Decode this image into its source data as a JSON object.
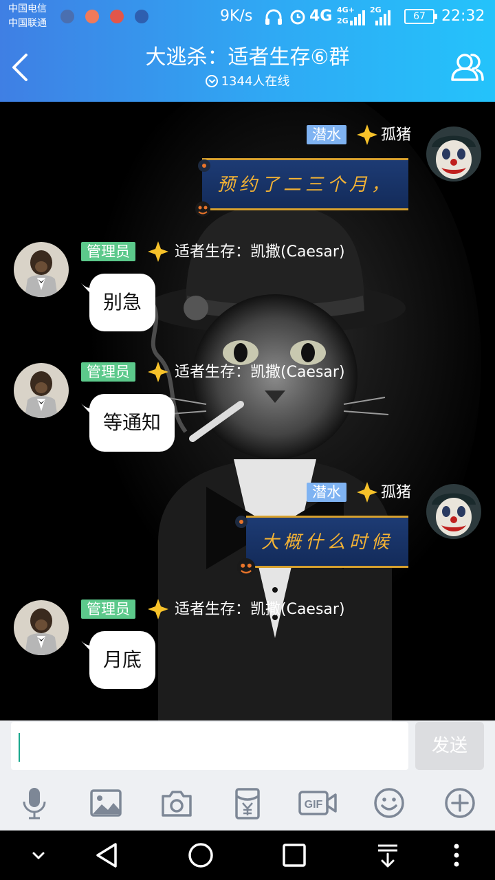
{
  "status_bar": {
    "carrier_1": "中国电信",
    "carrier_2": "中国联通",
    "net_speed": "9K/s",
    "net_4g": "4G",
    "net_4g_plus": "4G+",
    "net_2g_a": "2G",
    "net_2g_b": "2G",
    "battery": "67",
    "time": "22:32"
  },
  "header": {
    "title": "大逃杀：适者生存⑥群",
    "online_count": "1344人在线",
    "icons": [
      "back-arrow-icon",
      "members-icon",
      "chevron-down-icon"
    ]
  },
  "messages": [
    {
      "side": "right",
      "badge": "潜水",
      "sender": "孤猪",
      "text": "预约了二三个月，",
      "style": "fancy-bubble"
    },
    {
      "side": "left",
      "badge": "管理员",
      "sender": "适者生存：凯撒(Caesar)",
      "text": "别急",
      "style": "white-bubble"
    },
    {
      "side": "left",
      "badge": "管理员",
      "sender": "适者生存：凯撒(Caesar)",
      "text": "等通知",
      "style": "white-bubble"
    },
    {
      "side": "right",
      "badge": "潜水",
      "sender": "孤猪",
      "text": "大概什么时候",
      "style": "fancy-bubble"
    },
    {
      "side": "left",
      "badge": "管理员",
      "sender": "适者生存：凯撒(Caesar)",
      "text": "月底",
      "style": "white-bubble"
    }
  ],
  "input_bar": {
    "value": "",
    "send_label": "发送"
  },
  "toolbar": {
    "icons": [
      "microphone-icon",
      "image-icon",
      "camera-icon",
      "red-packet-icon",
      "gif-icon",
      "emoji-icon",
      "plus-icon"
    ],
    "gif_label": "GIF"
  },
  "colors": {
    "header_gradient_start": "#3f7fe4",
    "header_gradient_end": "#24c3fb",
    "badge_diver": "#7fb3f2",
    "badge_admin": "#5cc98b",
    "fancy_bubble_text": "#f3b234"
  }
}
